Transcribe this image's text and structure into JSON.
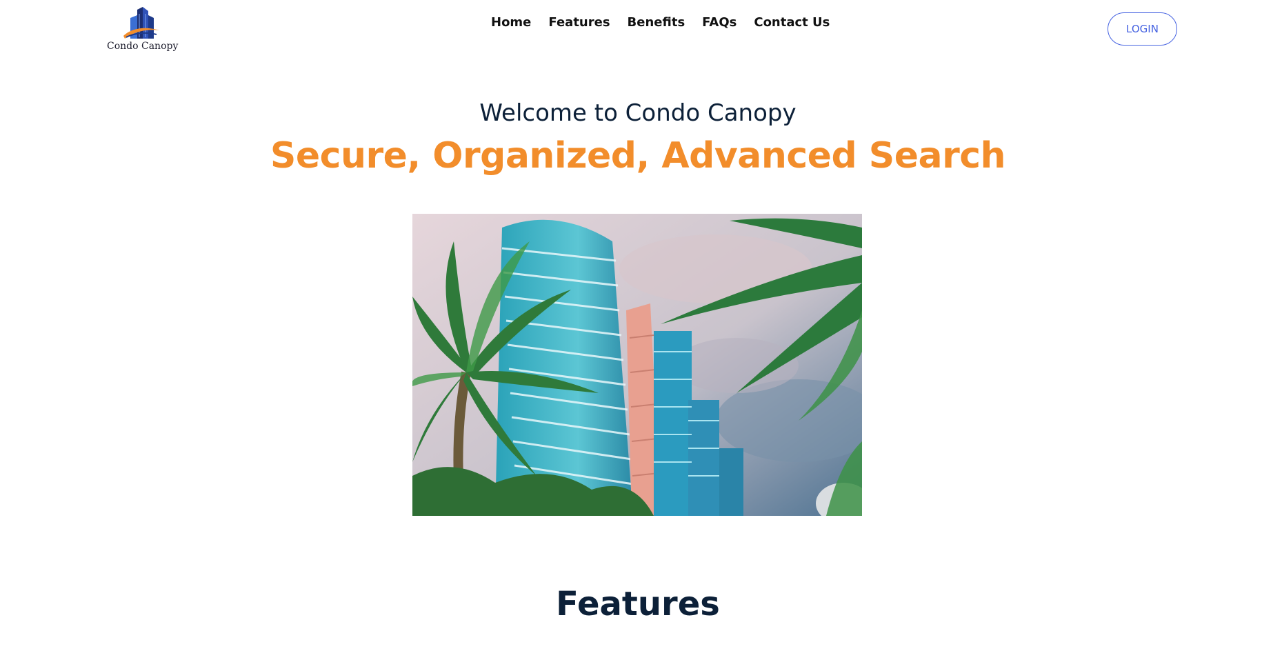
{
  "brand": {
    "name": "Condo Canopy"
  },
  "nav": {
    "items": [
      "Home",
      "Features",
      "Benefits",
      "FAQs",
      "Contact Us"
    ]
  },
  "header": {
    "login_label": "LOGIN"
  },
  "hero": {
    "subtitle": "Welcome to Condo Canopy",
    "title": "Secure, Organized, Advanced Search",
    "image_icon": "condo-towers-palm-trees-photo"
  },
  "features": {
    "heading": "Features"
  },
  "colors": {
    "accent_orange": "#f28d2b",
    "heading_navy": "#0c2038",
    "login_blue": "#4461e1"
  }
}
